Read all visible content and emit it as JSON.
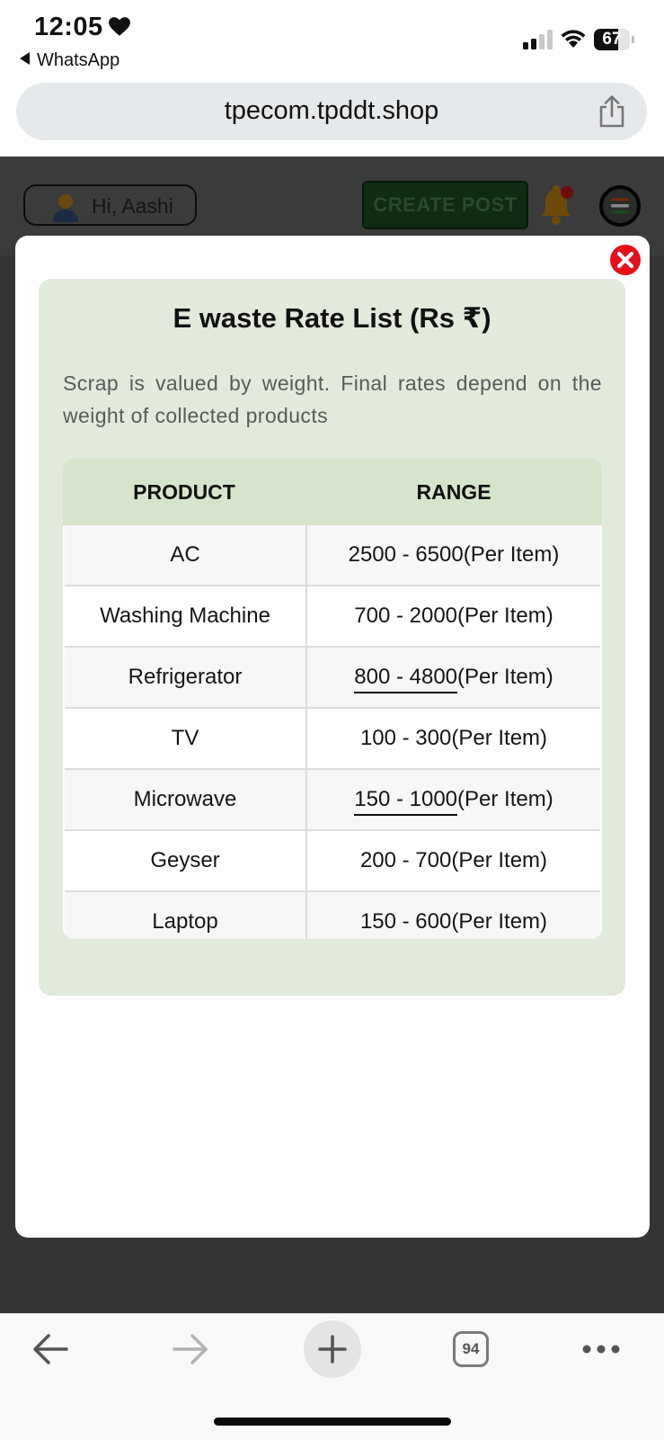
{
  "status_bar": {
    "time": "12:05",
    "back_app": "WhatsApp",
    "battery": "67"
  },
  "browser": {
    "url": "tpecom.tpddt.shop"
  },
  "site_header": {
    "greeting": "Hi, Aashi",
    "create_post": "CREATE POST"
  },
  "modal": {
    "title": "E waste Rate List (Rs ₹)",
    "description": "Scrap is valued by weight. Final rates depend on the weight of collected products",
    "table": {
      "headers": [
        "PRODUCT",
        "RANGE"
      ],
      "rows": [
        {
          "product": "AC",
          "range": "2500 - 6500",
          "suffix": "(Per Item)"
        },
        {
          "product": "Washing Machine",
          "range": "700 - 2000",
          "suffix": "(Per Item)"
        },
        {
          "product": "Refrigerator",
          "range": "800 - 4800",
          "suffix": "(Per Item)"
        },
        {
          "product": "TV",
          "range": "100 - 300",
          "suffix": "(Per Item)"
        },
        {
          "product": "Microwave",
          "range": "150 - 1000",
          "suffix": "(Per Item)"
        },
        {
          "product": "Geyser",
          "range": "200 - 700",
          "suffix": "(Per Item)"
        },
        {
          "product": "Laptop",
          "range": "150 - 600",
          "suffix": "(Per Item)"
        }
      ]
    }
  },
  "toolbar": {
    "tab_count": "94"
  },
  "colors": {
    "card_bg": "#e2eadc",
    "table_header_bg": "#d6e4cb",
    "close_red": "#e4101a",
    "overlay": "#333434"
  }
}
